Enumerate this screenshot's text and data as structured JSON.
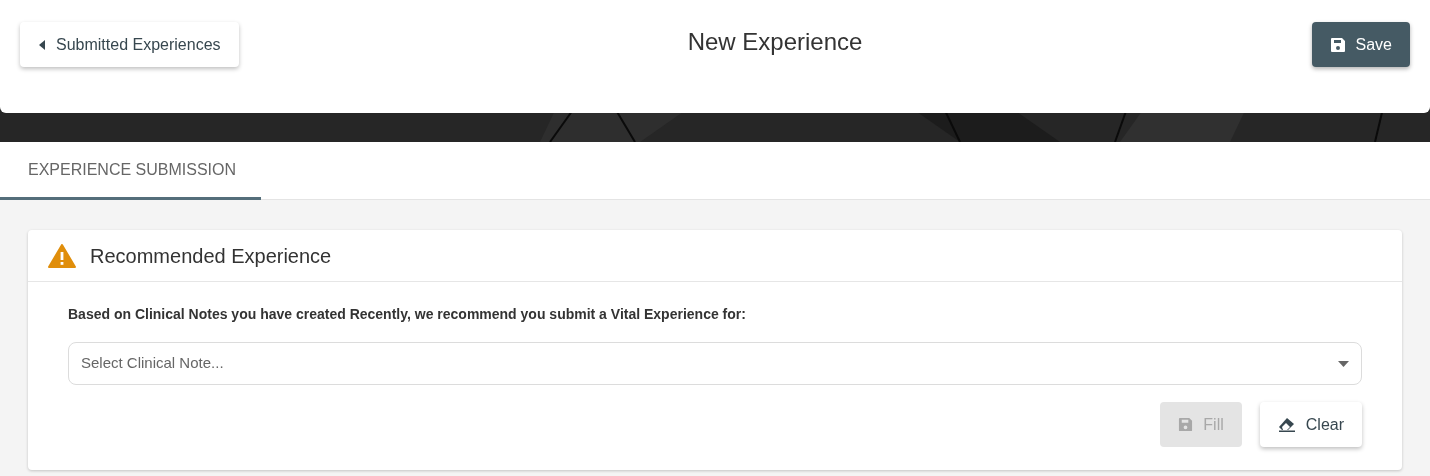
{
  "header": {
    "back_button": "Submitted Experiences",
    "title": "New Experience",
    "save_button": "Save"
  },
  "tabs": [
    {
      "label": "EXPERIENCE SUBMISSION",
      "selected": true
    }
  ],
  "card": {
    "title": "Recommended Experience",
    "prompt": "Based on Clinical Notes you have created Recently, we recommend you submit a Vital Experience for:",
    "select": {
      "placeholder": "Select Clinical Note..."
    },
    "buttons": [
      {
        "kind": "fill",
        "label": "Fill",
        "disabled": true
      },
      {
        "kind": "clear",
        "label": "Clear",
        "disabled": false
      }
    ]
  }
}
